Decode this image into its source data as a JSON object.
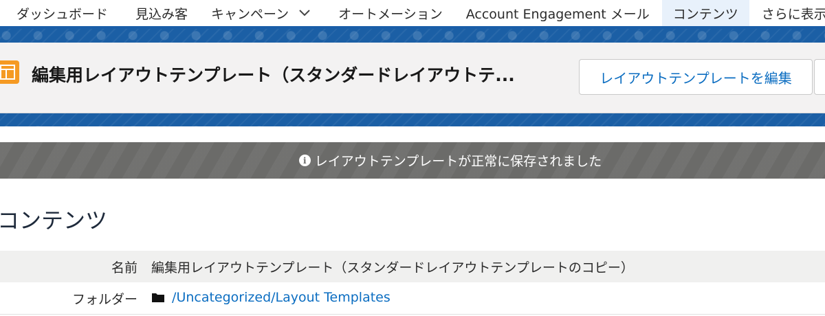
{
  "nav": {
    "items": [
      {
        "label": "ダッシュボード"
      },
      {
        "label": "見込み客"
      },
      {
        "label": "キャンペーン"
      },
      {
        "label": "オートメーション"
      },
      {
        "label": "Account Engagement メール"
      },
      {
        "label": "コンテンツ",
        "active": true
      },
      {
        "label": "さらに表示"
      }
    ]
  },
  "record": {
    "title": "編集用レイアウトテンプレート（スタンダードレイアウトテ...",
    "icon": "template-icon",
    "edit_button": "レイアウトテンプレートを編集"
  },
  "toast": {
    "icon": "info-icon",
    "message": "レイアウトテンプレートが正常に保存されました"
  },
  "section": {
    "title": "コンテンツ",
    "fields": [
      {
        "label": "名前",
        "value": "編集用レイアウトテンプレート（スタンダードレイアウトテンプレートのコピー）"
      },
      {
        "label": "フォルダー",
        "value": "/Uncategorized/Layout Templates"
      }
    ]
  },
  "colors": {
    "brand_blue": "#1b5fa5",
    "link": "#0b6dc1",
    "icon_orange": "#f59a23",
    "toast_gray": "#6b6b69",
    "active_tab_bg": "#e8f1fb"
  }
}
